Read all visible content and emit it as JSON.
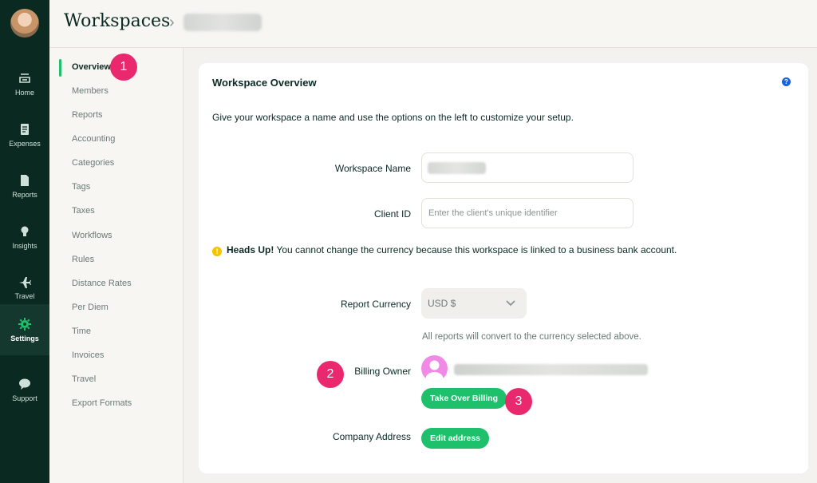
{
  "rail": {
    "items": [
      {
        "label": "Home",
        "icon": "inbox-icon"
      },
      {
        "label": "Expenses",
        "icon": "receipt-icon"
      },
      {
        "label": "Reports",
        "icon": "document-icon"
      },
      {
        "label": "Insights",
        "icon": "lightbulb-icon"
      },
      {
        "label": "Travel",
        "icon": "airplane-icon"
      },
      {
        "label": "Settings",
        "icon": "gear-icon",
        "active": true
      },
      {
        "label": "Support",
        "icon": "chat-icon"
      }
    ]
  },
  "header": {
    "title": "Workspaces",
    "chevron": "›"
  },
  "submenu": {
    "items": [
      "Overview",
      "Members",
      "Reports",
      "Accounting",
      "Categories",
      "Tags",
      "Taxes",
      "Workflows",
      "Rules",
      "Distance Rates",
      "Per Diem",
      "Time",
      "Invoices",
      "Travel",
      "Export Formats"
    ],
    "active": "Overview"
  },
  "badges": [
    "1",
    "2",
    "3"
  ],
  "card": {
    "title": "Workspace Overview",
    "help": "?",
    "description": "Give your workspace a name and use the options on the left to customize your setup.",
    "workspace_name_label": "Workspace Name",
    "client_id_label": "Client ID",
    "client_id_placeholder": "Enter the client's unique identifier",
    "heads_up_icon": "!",
    "heads_up_bold": "Heads Up!",
    "heads_up_text": " You cannot change the currency because this workspace is linked to a business bank account.",
    "report_currency_label": "Report Currency",
    "report_currency_value": "USD $",
    "currency_hint": "All reports will convert to the currency selected above.",
    "billing_owner_label": "Billing Owner",
    "take_over_billing": "Take Over Billing",
    "company_address_label": "Company Address",
    "edit_address": "Edit address"
  },
  "colors": {
    "rail_bg": "#0a2a21",
    "accent_green": "#1ec06b",
    "badge_pink": "#e9286e",
    "help_blue": "#1a63d8",
    "warn_yellow": "#f4c400"
  }
}
